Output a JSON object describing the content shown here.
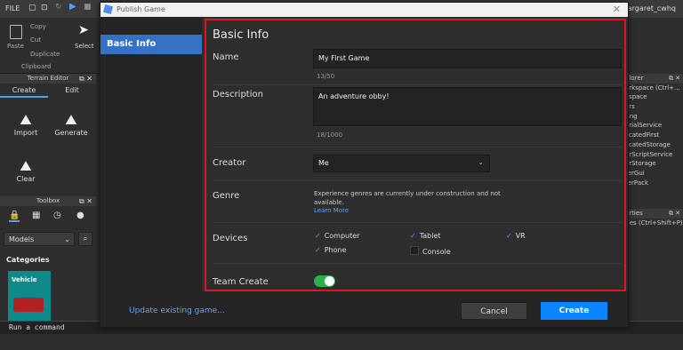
{
  "topbar": {
    "file": "FILE",
    "user": "margaret_cwhq"
  },
  "ribbon": {
    "paste": "Paste",
    "copy": "Copy",
    "cut": "Cut",
    "duplicate": "Duplicate",
    "select": "Select",
    "clipboard": "Clipboard"
  },
  "terrain": {
    "title": "Terrain Editor",
    "tabs": [
      "Create",
      "Edit"
    ],
    "tools": [
      "Import",
      "Generate",
      "Clear"
    ]
  },
  "toolbox": {
    "title": "Toolbox",
    "models": "Models",
    "categories": "Categories",
    "vehicle": "Vehicle"
  },
  "command": {
    "placeholder": "Run a command"
  },
  "explorer": {
    "title": "plorer",
    "filter": "orkspace (Ctrl+...",
    "items": [
      "kspace",
      "ers",
      "ting",
      "orialService",
      "licatedFirst",
      "licatedStorage",
      "erScriptService",
      "erStorage",
      "terGui",
      "terPack"
    ]
  },
  "properties": {
    "title": "erties",
    "filter": "ties (Ctrl+Shift+P)"
  },
  "dialog": {
    "title": "Publish Game",
    "nav": {
      "basic": "Basic Info"
    },
    "heading": "Basic Info",
    "name": {
      "label": "Name",
      "value": "My First Game",
      "count": "13/50"
    },
    "description": {
      "label": "Description",
      "value": "An adventure obby!",
      "count": "18/1000"
    },
    "creator": {
      "label": "Creator",
      "value": "Me"
    },
    "genre": {
      "label": "Genre",
      "note": "Experience genres are currently under construction and not available.",
      "link": "Learn More"
    },
    "devices": {
      "label": "Devices",
      "items": [
        {
          "name": "Computer",
          "checked": true
        },
        {
          "name": "Tablet",
          "checked": true
        },
        {
          "name": "VR",
          "checked": true
        },
        {
          "name": "Phone",
          "checked": true
        },
        {
          "name": "Console",
          "checked": false
        }
      ]
    },
    "team_create": {
      "label": "Team Create",
      "enabled": true
    },
    "footer": {
      "update": "Update existing game...",
      "cancel": "Cancel",
      "create": "Create"
    }
  },
  "colors": {
    "accent": "#0a84ff",
    "nav_selected": "#3672c4",
    "highlight": "#e0161e",
    "toggle_on": "#2fae4e"
  }
}
